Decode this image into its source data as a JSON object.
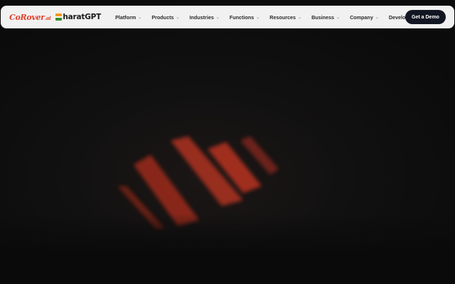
{
  "brand": {
    "corover": "CoRover",
    "corover_suffix": ".ai",
    "bharat": "harat",
    "bharat_suffix": "GPT"
  },
  "nav": {
    "items": [
      {
        "label": "Platform"
      },
      {
        "label": "Products"
      },
      {
        "label": "Industries"
      },
      {
        "label": "Functions"
      },
      {
        "label": "Resources"
      },
      {
        "label": "Business"
      },
      {
        "label": "Company"
      },
      {
        "label": "Developers"
      }
    ],
    "chevron_icon": "chevron-down-icon",
    "cta_label": "Get a Demo"
  },
  "colors": {
    "accent": "#e4402c",
    "cta_bg": "#111622",
    "stripe": "#c2341f"
  }
}
